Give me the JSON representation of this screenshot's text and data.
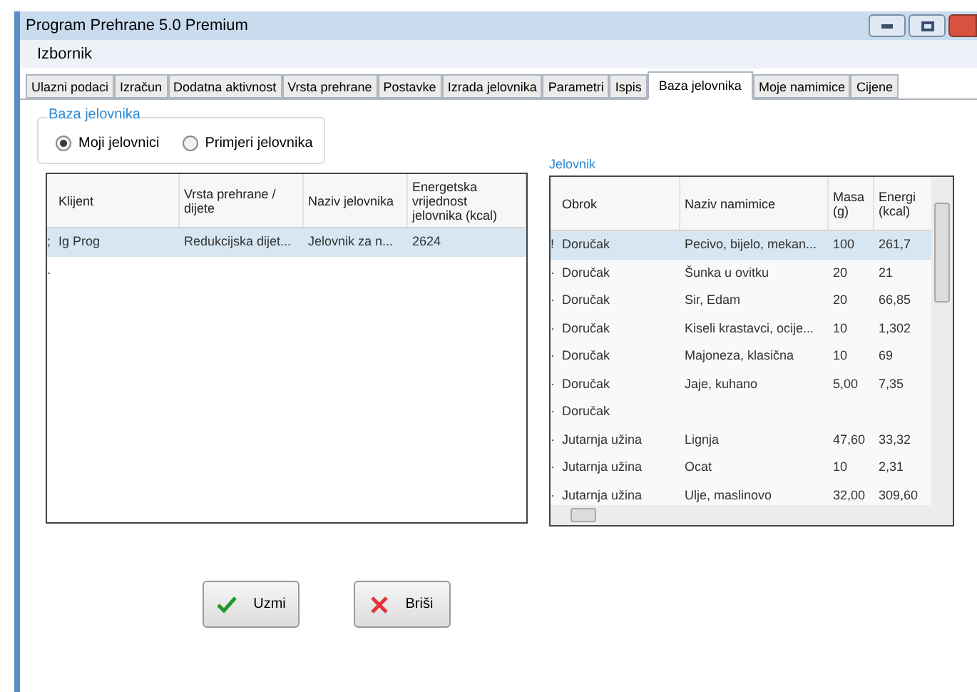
{
  "window": {
    "title": "Program Prehrane 5.0 Premium"
  },
  "menu": [
    "Izbornik"
  ],
  "tabs": [
    {
      "label": "Ulazni podaci",
      "selected": false
    },
    {
      "label": "Izračun",
      "selected": false
    },
    {
      "label": "Dodatna aktivnost",
      "selected": false
    },
    {
      "label": "Vrsta prehrane",
      "selected": false
    },
    {
      "label": "Postavke",
      "selected": false
    },
    {
      "label": "Izrada jelovnika",
      "selected": false
    },
    {
      "label": "Parametri",
      "selected": false
    },
    {
      "label": "Ispis",
      "selected": false
    },
    {
      "label": "Baza jelovnika",
      "selected": true
    },
    {
      "label": "Moje namimice",
      "selected": false
    },
    {
      "label": "Cijene",
      "selected": false
    }
  ],
  "source_group": {
    "title": "Baza jelovnika",
    "options": [
      {
        "label": "Moji jelovnici",
        "selected": true
      },
      {
        "label": "Primjeri jelovnika",
        "selected": false
      }
    ]
  },
  "menus_table": {
    "columns": [
      "Klijent",
      "Vrsta prehrane / dijete",
      "Naziv jelovnika",
      "Energetska vrijednost jelovnika (kcal)"
    ],
    "rows": [
      {
        "marker": ";",
        "selected": true,
        "cells": [
          "Ig Prog",
          "Redukcijska dijet...",
          "Jelovnik za n...",
          "2624"
        ]
      },
      {
        "marker": ".",
        "selected": false
      }
    ]
  },
  "menu_panel": {
    "title": "Jelovnik",
    "columns": [
      "Obrok",
      "Naziv namimice",
      "Masa (g)",
      "Energi (kcal)"
    ],
    "rows": [
      {
        "marker": "!",
        "selected": true,
        "cells": [
          "Doručak",
          "Pecivo, bijelo, mekan...",
          "100",
          "261,7"
        ]
      },
      {
        "marker": "·",
        "selected": false,
        "cells": [
          "Doručak",
          "Šunka u ovitku",
          "20",
          "21"
        ]
      },
      {
        "marker": "·",
        "selected": false,
        "cells": [
          "Doručak",
          "Sir, Edam",
          "20",
          "66,85"
        ]
      },
      {
        "marker": "·",
        "selected": false,
        "cells": [
          "Doručak",
          "Kiseli krastavci, ocije...",
          "10",
          "1,302"
        ]
      },
      {
        "marker": "·",
        "selected": false,
        "cells": [
          "Doručak",
          "Majoneza, klasična",
          "10",
          "69"
        ]
      },
      {
        "marker": "·",
        "selected": false,
        "cells": [
          "Doručak",
          "Jaje, kuhano",
          "5,00",
          "7,35"
        ]
      },
      {
        "marker": "·",
        "selected": false,
        "cells": [
          "Doručak"
        ]
      },
      {
        "marker": "·",
        "selected": false,
        "cells": [
          "Jutarnja užina",
          "Lignja",
          "47,60",
          "33,32"
        ]
      },
      {
        "marker": "·",
        "selected": false,
        "cells": [
          "Jutarnja užina",
          "Ocat",
          "10",
          "2,31"
        ]
      },
      {
        "marker": "·",
        "selected": false,
        "cells": [
          "Jutarnja užina",
          "Ulje, maslinovo",
          "32,00",
          "309,60"
        ]
      }
    ]
  },
  "buttons": [
    {
      "kind": "take",
      "label": "Uzmi"
    },
    {
      "kind": "delete",
      "label": "Briši"
    }
  ]
}
